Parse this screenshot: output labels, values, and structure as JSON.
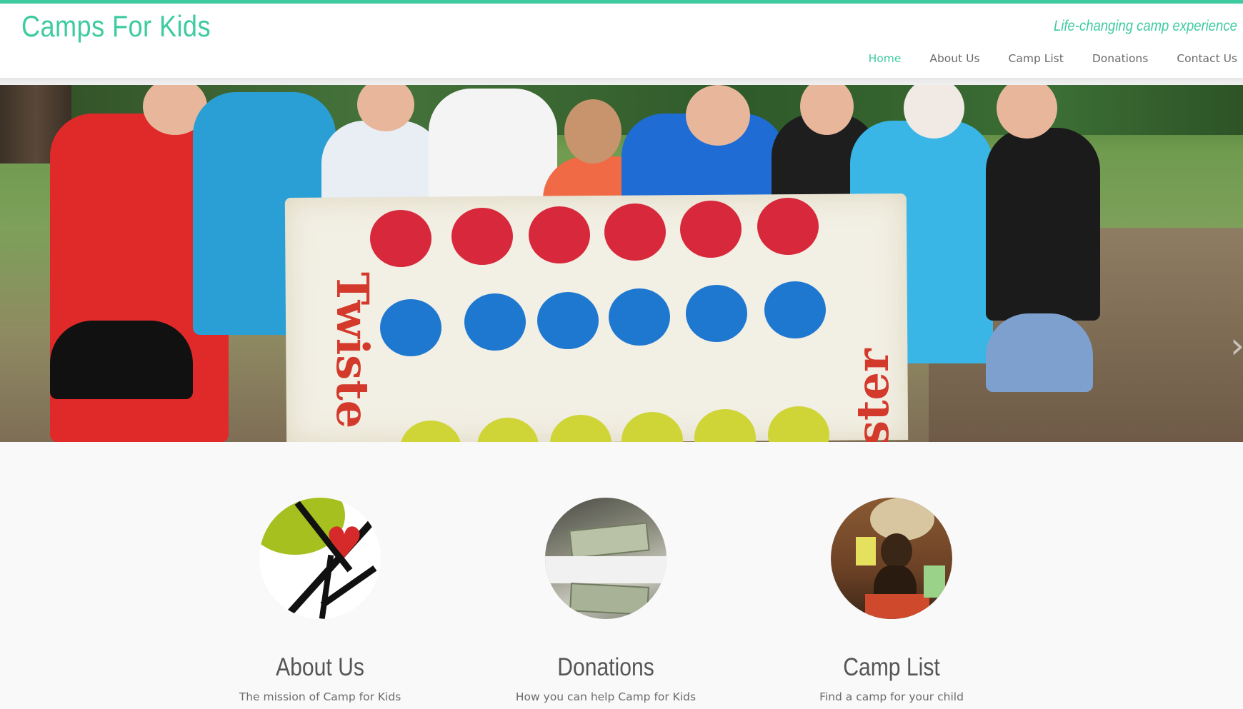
{
  "header": {
    "site_title": "Camps For Kids",
    "tagline": "Life-changing camp experience",
    "accent_color": "#3ecba0"
  },
  "nav": {
    "items": [
      {
        "label": "Home",
        "active": true
      },
      {
        "label": "About Us",
        "active": false
      },
      {
        "label": "Camp List",
        "active": false
      },
      {
        "label": "Donations",
        "active": false
      },
      {
        "label": "Contact Us",
        "active": false
      }
    ]
  },
  "hero": {
    "banner_text_left": "Twiste",
    "banner_text_right": "ster",
    "next_icon": "chevron-right-icon"
  },
  "features": [
    {
      "title": "About Us",
      "subtitle": "The mission of Camp for Kids",
      "icon": "house-heart-image"
    },
    {
      "title": "Donations",
      "subtitle": "How you can help Camp for Kids",
      "icon": "money-image"
    },
    {
      "title": "Camp List",
      "subtitle": "Find a camp for your child",
      "icon": "campers-image"
    }
  ]
}
